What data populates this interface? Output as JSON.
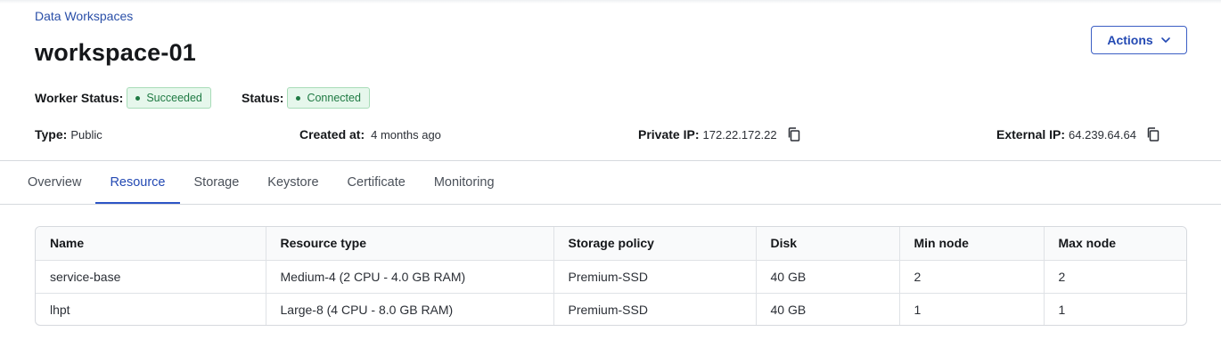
{
  "breadcrumb": "Data Workspaces",
  "title": "workspace-01",
  "actions": {
    "label": "Actions",
    "icon": "chevron-down-icon"
  },
  "worker_status": {
    "label": "Worker Status:",
    "value": "Succeeded",
    "color": "#1f7a43"
  },
  "status": {
    "label": "Status:",
    "value": "Connected",
    "color": "#1f7a43"
  },
  "info": {
    "type": {
      "label": "Type:",
      "value": "Public"
    },
    "created": {
      "label": "Created at:",
      "value": "4 months ago"
    },
    "private_ip": {
      "label": "Private IP:",
      "value": "172.22.172.22",
      "icon": "copy-icon"
    },
    "external_ip": {
      "label": "External IP:",
      "value": "64.239.64.64",
      "icon": "copy-icon"
    }
  },
  "tabs": [
    {
      "label": "Overview",
      "active": false
    },
    {
      "label": "Resource",
      "active": true
    },
    {
      "label": "Storage",
      "active": false
    },
    {
      "label": "Keystore",
      "active": false
    },
    {
      "label": "Certificate",
      "active": false
    },
    {
      "label": "Monitoring",
      "active": false
    }
  ],
  "table": {
    "columns": [
      "Name",
      "Resource type",
      "Storage policy",
      "Disk",
      "Min node",
      "Max node"
    ],
    "rows": [
      [
        "service-base",
        "Medium-4 (2 CPU - 4.0 GB RAM)",
        "Premium-SSD",
        "40 GB",
        "2",
        "2"
      ],
      [
        "lhpt",
        "Large-8 (4 CPU - 8.0 GB RAM)",
        "Premium-SSD",
        "40 GB",
        "1",
        "1"
      ]
    ]
  },
  "colors": {
    "accent": "#2349b3",
    "success_bg": "#e6f7ec",
    "border": "#d6d9de"
  }
}
